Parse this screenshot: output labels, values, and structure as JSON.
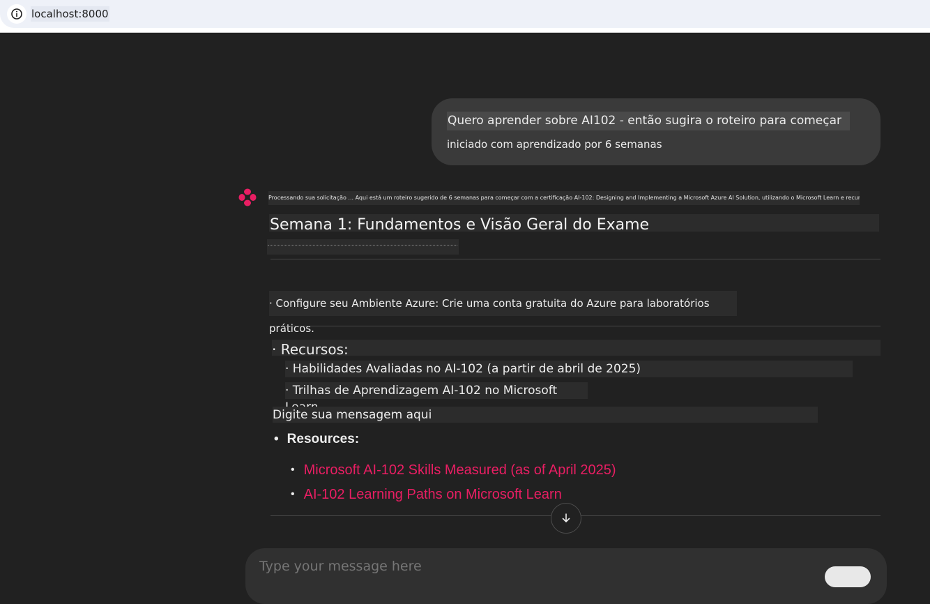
{
  "browser": {
    "url": "localhost:8000"
  },
  "user_message": {
    "line1": "Quero aprender sobre AI102 - então sugira o roteiro para começar",
    "line2": "iniciado com aprendizado por 6 semanas"
  },
  "assistant": {
    "processing_text": "Processando sua solicitação ... Aqui está um roteiro sugerido de 6 semanas para começar com a certificação AI-102: Designing and Implementing a Microsoft Azure AI Solution, utilizando o Microsoft Learn e recursos oficiais:",
    "week_title": "Semana 1: Fundamentos e Visão Geral do Exame",
    "configure_text": "· Configure seu Ambiente Azure: Crie uma conta gratuita do Azure para laboratórios práticos.",
    "recursos_heading": "· Recursos:",
    "recursos_items": [
      "· Habilidades Avaliadas no AI-102 (a partir de abril de 2025)",
      "· Trilhas de Aprendizagem AI-102 no Microsoft Learn"
    ],
    "input_prompt": "Digite sua mensagem aqui",
    "resources_heading": "Resources:",
    "resource_links": [
      "Microsoft AI-102 Skills Measured (as of April 2025)",
      "AI-102 Learning Paths on Microsoft Learn"
    ],
    "bullet": "•"
  },
  "composer": {
    "placeholder": "Type your message here"
  },
  "colors": {
    "background": "#212121",
    "accent_link": "#e91e63",
    "bubble": "#3a3a3a"
  },
  "icons": {
    "info": "info-icon",
    "avatar": "assistant-logo-icon",
    "scroll": "arrow-down-icon"
  }
}
